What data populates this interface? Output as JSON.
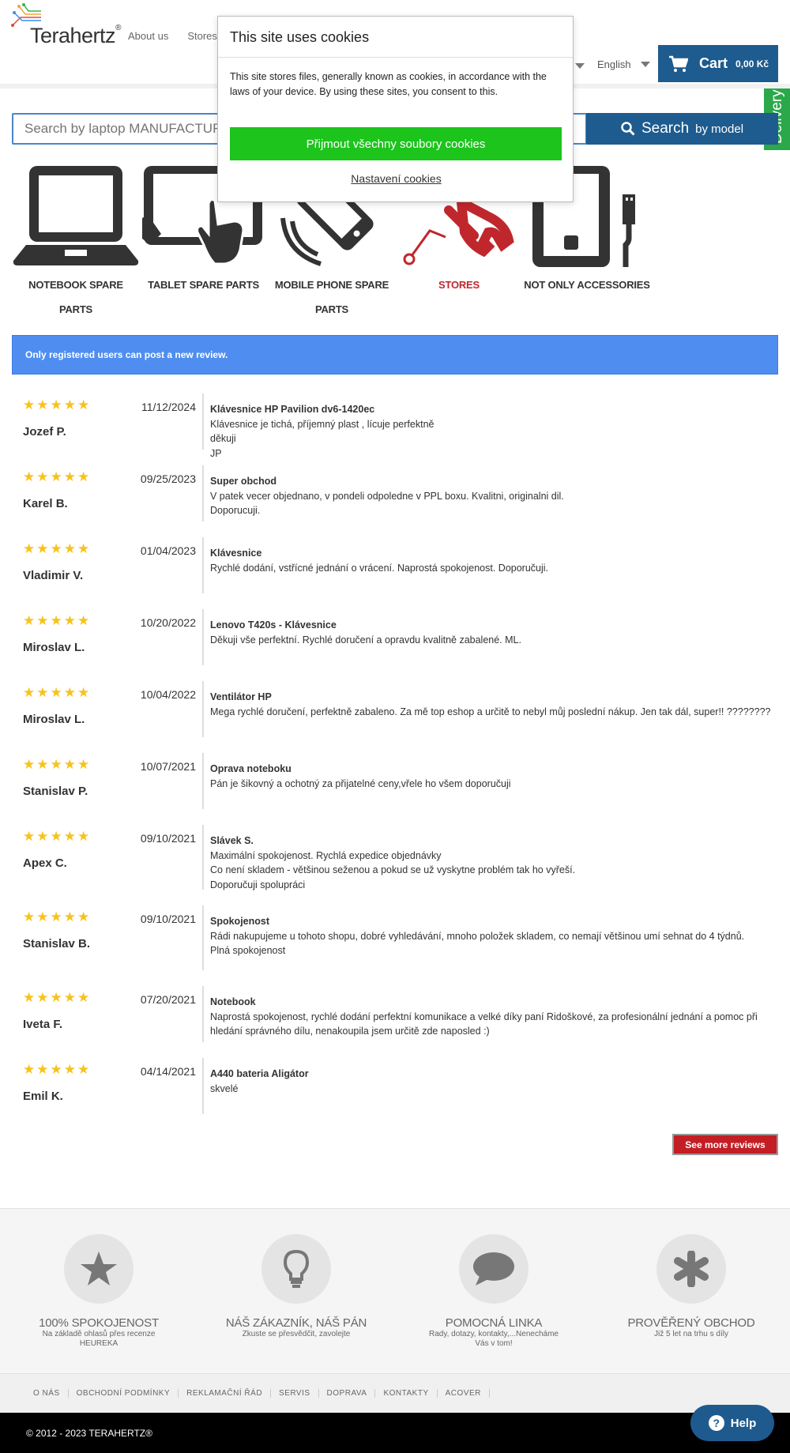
{
  "header": {
    "logo_text": "Terahertz",
    "logo_reg": "®",
    "nav": [
      "About us",
      "Stores"
    ],
    "language": "English",
    "cart_label": "Cart",
    "cart_amount": "0,00 Kč"
  },
  "delivery_tab": "Delivery",
  "search": {
    "placeholder": "Search by laptop MANUFACTURER",
    "button_big": "Search",
    "button_small": "by model"
  },
  "categories": [
    {
      "label": "NOTEBOOK SPARE PARTS",
      "icon": "laptop-icon"
    },
    {
      "label": "TABLET SPARE PARTS",
      "icon": "tablet-icon"
    },
    {
      "label": "MOBILE PHONE SPARE PARTS",
      "icon": "phone-icon"
    },
    {
      "label": "STORES",
      "icon": "wrench-icon",
      "color": "#c0272d"
    },
    {
      "label": "NOT ONLY ACCESSORIES",
      "icon": "accessories-icon"
    }
  ],
  "notice": "Only registered users can post a new review.",
  "reviews": [
    {
      "rating": 5,
      "date": "11/12/2024",
      "author": "Jozef P.",
      "title": "Klávesnice HP Pavilion dv6-1420ec",
      "lines": [
        "Klávesnice je tichá, příjemný plast , lícuje perfektně",
        "děkuji",
        "JP"
      ]
    },
    {
      "rating": 5,
      "date": "09/25/2023",
      "author": "Karel B.",
      "title": "Super obchod",
      "lines": [
        "V patek vecer objednano, v pondeli odpoledne v PPL boxu. Kvalitni, originalni dil.",
        "Doporucuji."
      ]
    },
    {
      "rating": 5,
      "date": "01/04/2023",
      "author": "Vladimir V.",
      "title": "Klávesnice",
      "lines": [
        "Rychlé dodání, vstřícné jednání o vrácení. Naprostá spokojenost. Doporučuji."
      ]
    },
    {
      "rating": 5,
      "date": "10/20/2022",
      "author": "Miroslav L.",
      "title": "Lenovo T420s - Klávesnice",
      "lines": [
        "Děkuji vše perfektní. Rychlé doručení a opravdu kvalitně zabalené. ML."
      ]
    },
    {
      "rating": 5,
      "date": "10/04/2022",
      "author": "Miroslav L.",
      "title": "Ventilátor HP",
      "lines": [
        "Mega rychlé doručení, perfektně zabaleno. Za mě top eshop a určitě to nebyl můj poslední nákup. Jen tak dál, super!! ????????"
      ]
    },
    {
      "rating": 5,
      "date": "10/07/2021",
      "author": "Stanislav P.",
      "title": "Oprava noteboku",
      "lines": [
        "Pán je šikovný a ochotný za přijatelné ceny,vřele ho všem doporučuji"
      ]
    },
    {
      "rating": 5,
      "date": "09/10/2021",
      "author": "Apex C.",
      "title": "Slávek S.",
      "lines": [
        "Maximální spokojenost. Rychlá expedice objednávky",
        "Co není skladem - většinou seženou a pokud se už vyskytne problém tak ho vyřeší.",
        "Doporučuji spolupráci"
      ]
    },
    {
      "rating": 5,
      "date": "09/10/2021",
      "author": "Stanislav B.",
      "title": "Spokojenost",
      "lines": [
        "Rádi nakupujeme u tohoto shopu, dobré vyhledávání, mnoho položek skladem, co nemají většinou umí sehnat do 4 týdnů.",
        "Plná spokojenost"
      ]
    },
    {
      "rating": 5,
      "date": "07/20/2021",
      "author": "Iveta F.",
      "title": "Notebook",
      "lines": [
        "Naprostá spokojenost, rychlé dodání perfektní komunikace a velké díky paní Ridoškové, za profesionální jednání a pomoc při hledání správného dílu, nenakoupila jsem určitě zde naposled :)"
      ]
    },
    {
      "rating": 5,
      "date": "04/14/2021",
      "author": "Emil K.",
      "title": "A440 bateria Aligátor",
      "lines": [
        "skvelé"
      ]
    }
  ],
  "more_reviews": "See more reviews",
  "features": [
    {
      "icon": "star-icon",
      "title": "100% SPOKOJENOST",
      "subtitle": "Na základě ohlasů přes recenze HEUREKA"
    },
    {
      "icon": "lightbulb-icon",
      "title": "NÁŠ ZÁKAZNÍK, NÁŠ PÁN",
      "subtitle": "Zkuste se přesvědčit, zavolejte"
    },
    {
      "icon": "speech-bubble-icon",
      "title": "POMOCNÁ LINKA",
      "subtitle": "Rady, dotazy, kontakty,...Nenecháme Vás v tom!"
    },
    {
      "icon": "asterisk-icon",
      "title": "PROVĚŘENÝ OBCHOD",
      "subtitle": "Již 5 let na trhu s díly"
    }
  ],
  "footer_links": [
    "O NÁS",
    "OBCHODNÍ PODMÍNKY",
    "REKLAMAČNÍ ŘÁD",
    "SERVIS",
    "DOPRAVA",
    "KONTAKTY",
    "ACOVER"
  ],
  "copyright": "© 2012 - 2023 TERAHERTZ®",
  "help": "Help",
  "cookie": {
    "title": "This site uses cookies",
    "body": "This site stores files, generally known as cookies, in accordance with the laws of your device. By using these sites, you consent to this.",
    "accept": "Přijmout všechny soubory cookies",
    "settings": "Nastavení cookies"
  },
  "colors": {
    "brand_blue": "#1e5b8e",
    "notice_blue": "#4f8ef0",
    "star": "#f7c21b",
    "accept_green": "#1cc41c",
    "more_red": "#c41e25"
  }
}
